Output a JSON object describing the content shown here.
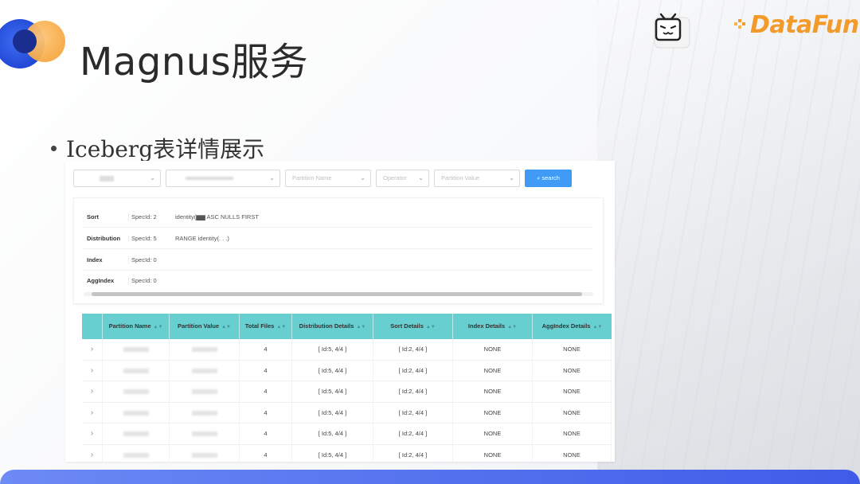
{
  "slide": {
    "title": "Magnus服务",
    "bullet": "Iceberg表详情展示",
    "brand": "DataFun."
  },
  "filters": {
    "partition_name_placeholder": "Partition Name",
    "operator_placeholder": "Operator",
    "partition_value_placeholder": "Partition Value",
    "search_label": "search"
  },
  "info": {
    "rows": [
      {
        "key": "Sort",
        "spec": "SpecId: 2",
        "value": "identity(▆▆ ASC NULLS FIRST"
      },
      {
        "key": "Distribution",
        "spec": "SpecId: 5",
        "value": "RANGE identity(. . .)"
      },
      {
        "key": "Index",
        "spec": "SpecId: 0",
        "value": ""
      },
      {
        "key": "AggIndex",
        "spec": "SpecId: 0",
        "value": ""
      }
    ]
  },
  "table": {
    "columns": [
      "Partition Name",
      "Partition Value",
      "Total Files",
      "Distribution Details",
      "Sort Details",
      "Index Details",
      "AggIndex Details"
    ],
    "rows": [
      {
        "total_files": "4",
        "distribution": "[ Id:5, 4/4 ]",
        "sort": "[ Id:2, 4/4 ]",
        "index": "NONE",
        "aggindex": "NONE"
      },
      {
        "total_files": "4",
        "distribution": "[ Id:5, 4/4 ]",
        "sort": "[ Id:2, 4/4 ]",
        "index": "NONE",
        "aggindex": "NONE"
      },
      {
        "total_files": "4",
        "distribution": "[ Id:5, 4/4 ]",
        "sort": "[ Id:2, 4/4 ]",
        "index": "NONE",
        "aggindex": "NONE"
      },
      {
        "total_files": "4",
        "distribution": "[ Id:5, 4/4 ]",
        "sort": "[ Id:2, 4/4 ]",
        "index": "NONE",
        "aggindex": "NONE"
      },
      {
        "total_files": "4",
        "distribution": "[ Id:5, 4/4 ]",
        "sort": "[ Id:2, 4/4 ]",
        "index": "NONE",
        "aggindex": "NONE"
      },
      {
        "total_files": "4",
        "distribution": "[ Id:5, 4/4 ]",
        "sort": "[ Id:2, 4/4 ]",
        "index": "NONE",
        "aggindex": "NONE"
      }
    ]
  },
  "colors": {
    "header_teal": "#67cfd0",
    "search_blue": "#3f9bf5",
    "brand_orange": "#f29b2a",
    "accent_blue": "#2148d6"
  },
  "icons": {
    "expand": "chevron-right-icon",
    "search": "search-icon",
    "sort": "sort-icon",
    "dropdown": "chevron-down-icon"
  }
}
